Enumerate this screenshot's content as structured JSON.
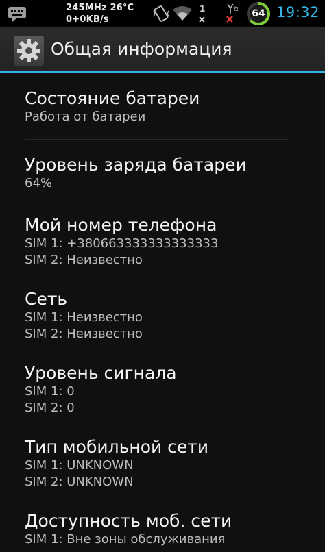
{
  "status_bar": {
    "notification_icon": "keyboard-notification-icon",
    "net_speed_line1": "245MHz 26°C",
    "net_speed_line2": "0+0KB/s",
    "icons": [
      "vibrate-icon",
      "wifi-icon",
      "data-transfer-icon",
      "signal-no-service-icon"
    ],
    "battery_level": "64",
    "time": "19:32"
  },
  "action_bar": {
    "icon": "settings-gear-icon",
    "title": "Общая информация"
  },
  "items": [
    {
      "title": "Состояние батареи",
      "lines": [
        "Работа от батареи"
      ]
    },
    {
      "title": "Уровень заряда батареи",
      "lines": [
        "64%"
      ]
    },
    {
      "title": "Мой номер телефона",
      "lines": [
        "SIM 1: +380663333333333333",
        "SIM 2: Неизвестно"
      ]
    },
    {
      "title": "Сеть",
      "lines": [
        "SIM 1: Неизвестно",
        "SIM 2: Неизвестно"
      ]
    },
    {
      "title": "Уровень сигнала",
      "lines": [
        "SIM 1: 0",
        "SIM 2: 0"
      ]
    },
    {
      "title": "Тип мобильной сети",
      "lines": [
        "SIM 1: UNKNOWN",
        "SIM 2: UNKNOWN"
      ]
    },
    {
      "title": "Доступность моб. сети",
      "lines": [
        "SIM 1: Вне зоны обслуживания"
      ]
    }
  ],
  "colors": {
    "accent": "#33b5e5",
    "battery_ring": "#7fcf3a",
    "no_signal_x": "#e53935"
  }
}
